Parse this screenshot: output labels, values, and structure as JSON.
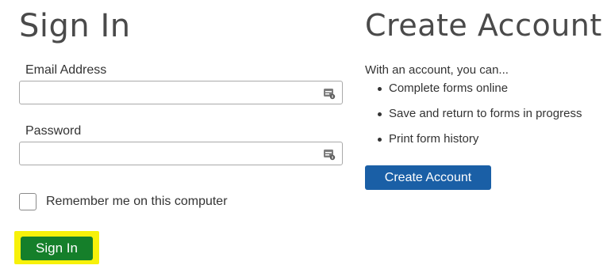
{
  "signin": {
    "title": "Sign In",
    "email_label": "Email Address",
    "email_value": "",
    "password_label": "Password",
    "password_value": "",
    "remember_label": "Remember me on this computer",
    "remember_checked": false,
    "submit_label": "Sign In",
    "field_icon": "password-manager-icon"
  },
  "create_account": {
    "title": "Create Account",
    "intro": "With an account, you can...",
    "benefits": [
      "Complete forms online",
      "Save and return to forms in progress",
      "Print form history"
    ],
    "button_label": "Create Account"
  },
  "colors": {
    "signin_button": "#157f2a",
    "signin_highlight": "#f7f10a",
    "create_button": "#1a5fa6"
  }
}
